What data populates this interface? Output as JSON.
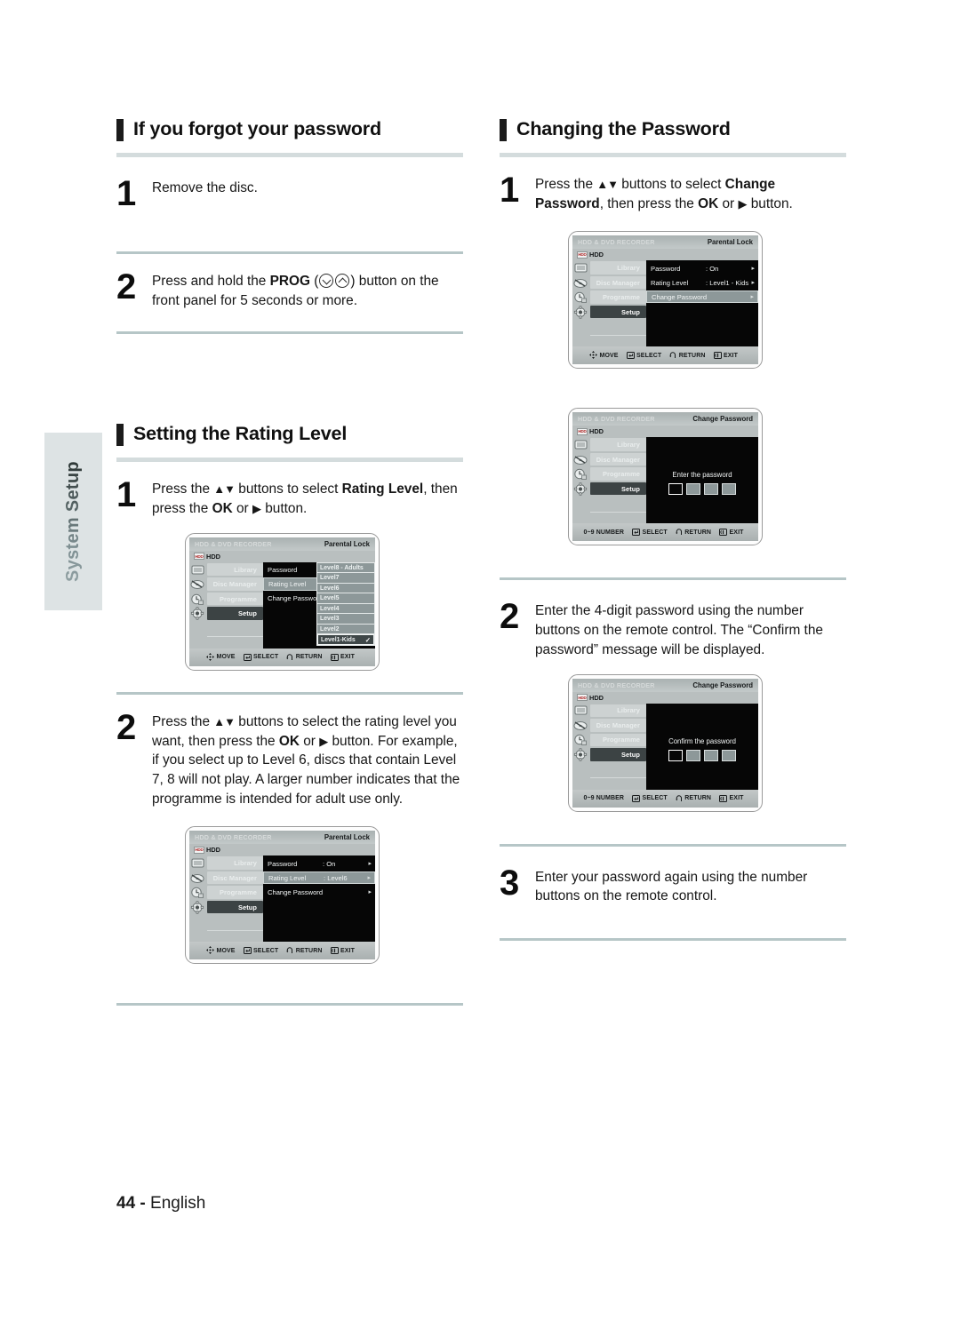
{
  "side_tab": {
    "label": "System Setup"
  },
  "footer": {
    "page_number": "44",
    "dash": "-",
    "language": "English"
  },
  "left_column": {
    "section1": {
      "title": "If you forgot your password",
      "steps": [
        {
          "num": "1",
          "text": "Remove the disc."
        },
        {
          "num": "2",
          "text_before": "Press and hold the ",
          "bold": "PROG",
          "text_mid": " (",
          "icon_down": "chevron-down-circle-icon",
          "icon_up": "chevron-up-circle-icon",
          "text_after": ") button on the front panel for 5 seconds or more."
        }
      ]
    },
    "section2": {
      "title": "Setting the Rating Level",
      "steps": [
        {
          "num": "1",
          "t1": "Press the ",
          "arrows": "▲▼",
          "t2": " buttons to select ",
          "b1": "Rating Level",
          "t3": ", then press the ",
          "b2": "OK",
          "t4": " or ",
          "tri": "▶",
          "t5": " button."
        },
        {
          "num": "2",
          "t1": "Press the ",
          "arrows": "▲▼",
          "t2": " buttons to select the rating level you want, then press the ",
          "b2": "OK",
          "t4": " or ",
          "tri": "▶",
          "t5": " button.",
          "extra": "For example, if you select up to Level 6, discs that contain Level 7, 8 will not play. A larger number indicates that the programme is intended for adult use only."
        }
      ]
    }
  },
  "right_column": {
    "section1": {
      "title": "Changing the Password",
      "steps": [
        {
          "num": "1",
          "t1": "Press the ",
          "arrows": "▲▼",
          "t2": " buttons to select ",
          "b1": "Change Password",
          "t3": ", then press the ",
          "b2": "OK",
          "t4": " or ",
          "tri": "▶",
          "t5": " button."
        },
        {
          "num": "2",
          "t1": "Enter the 4-digit password using the number buttons on the remote control.",
          "extra": "The “Confirm the password” message will be displayed."
        },
        {
          "num": "3",
          "t1": "Enter your password again using the number buttons on the remote control."
        }
      ]
    }
  },
  "osd": {
    "brand": "HDD & DVD RECORDER",
    "hdd_badge": "HDD",
    "hdd_label": "HDD",
    "rail": [
      {
        "label": "Library",
        "icon": "library-tape-icon"
      },
      {
        "label": "Disc Manager",
        "icon": "disc-manager-icon"
      },
      {
        "label": "Programme",
        "icon": "programme-clock-icon"
      },
      {
        "label": "Setup",
        "icon": "setup-gear-icon"
      }
    ],
    "hints_move": {
      "glyph": "four-way-arrow-icon",
      "label": "MOVE"
    },
    "hints_number": {
      "label": "0~9 NUMBER"
    },
    "hints_select": {
      "glyph": "enter-key-icon",
      "label": "SELECT"
    },
    "hints_return": {
      "glyph": "return-arrow-icon",
      "label": "RETURN"
    },
    "hints_exit": {
      "glyph": "exit-icon",
      "label": "EXIT"
    },
    "arrow_glyph": "▸",
    "check_glyph": "✓",
    "screens": {
      "parental_lock_change_pw": {
        "title": "Parental Lock",
        "rows": [
          {
            "name": "Password",
            "value": ": On",
            "selected": false
          },
          {
            "name": "Rating Level",
            "value": ": Level1 - Kids",
            "selected": false
          },
          {
            "name": "Change Password",
            "value": "",
            "selected": true
          }
        ]
      },
      "parental_lock_rating_dropdown": {
        "title": "Parental Lock",
        "rows": [
          {
            "name": "Password",
            "value": "",
            "selected": false
          },
          {
            "name": "Rating Level",
            "value": "",
            "selected": true
          },
          {
            "name": "Change Password",
            "value": "",
            "selected": false
          }
        ],
        "dropdown": [
          {
            "label": "Level8 - Adults",
            "checked": false
          },
          {
            "label": "Level7",
            "checked": false
          },
          {
            "label": "Level6",
            "checked": false
          },
          {
            "label": "Level5",
            "checked": false
          },
          {
            "label": "Level4",
            "checked": false
          },
          {
            "label": "Level3",
            "checked": false
          },
          {
            "label": "Level2",
            "checked": false
          },
          {
            "label": "Level1-Kids",
            "checked": true
          }
        ]
      },
      "parental_lock_level6": {
        "title": "Parental Lock",
        "rows": [
          {
            "name": "Password",
            "value": ": On",
            "selected": false
          },
          {
            "name": "Rating Level",
            "value": ": Level6",
            "selected": true
          },
          {
            "name": "Change Password",
            "value": "",
            "selected": false
          }
        ]
      },
      "enter_password": {
        "title": "Change Password",
        "message": "Enter the password",
        "boxes": 4,
        "active_box": 1
      },
      "confirm_password": {
        "title": "Change Password",
        "message": "Confirm the password",
        "boxes": 4,
        "active_box": 1
      }
    }
  },
  "colors": {
    "rule_thick": "#d4dcdd",
    "rule_thin": "#b6c6c7",
    "osd_panel": "#b9bfbf",
    "osd_pane": "#060606",
    "osd_highlight": "#8d9899",
    "osd_active_rail": "#3c4344",
    "side_tab_bg": "#dde3e4"
  }
}
